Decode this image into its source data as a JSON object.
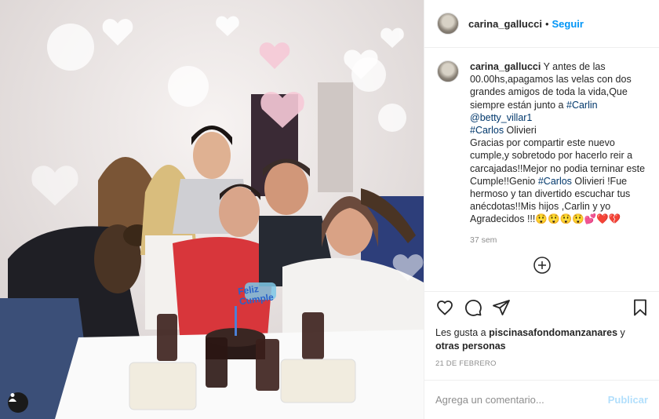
{
  "post": {
    "username": "carina_gallucci",
    "follow_label": "Seguir",
    "dot": "•",
    "caption": {
      "username": "carina_gallucci",
      "text_1": " Y antes de las 00.00hs,apagamos las velas con dos grandes amigos de toda la vida,Que siempre están junto a ",
      "tag_1": "#Carlin",
      "mention_1": "@betty_villar1",
      "tag_2": "#Carlos",
      "text_2": " Olivieri",
      "text_3": "Gracias por compartir este nuevo cumple,y sobretodo por hacerlo reir a carcajadas!!Mejor no podia terninar este Cumple!!Genio ",
      "tag_3": "#Carlos",
      "text_4": " Olivieri !Fue hermoso y tan divertido escuchar tus anécdotas!!Mis hijos ,Carlin y yo Agradecidos !!!",
      "emojis": "😲😲😲😲💕❤️💔"
    },
    "caption_time": "37 sem",
    "likes": {
      "prefix": "Les gusta a ",
      "user": "piscinasafondomanzanares",
      "middle": " y ",
      "others": "otras personas"
    },
    "date": "21 DE FEBRERO",
    "comment_placeholder": "Agrega un comentario...",
    "publish_label": "Publicar"
  },
  "photo": {
    "cake_topper": "Feliz Cumple"
  },
  "icons": {
    "like": "heart-icon",
    "comment": "comment-icon",
    "share": "share-icon",
    "save": "bookmark-icon",
    "more": "plus-circle-icon",
    "user_tag": "user-tag-icon"
  },
  "colors": {
    "link": "#0095f6",
    "hashtag": "#00376b",
    "publish_disabled": "#b2dffc"
  }
}
